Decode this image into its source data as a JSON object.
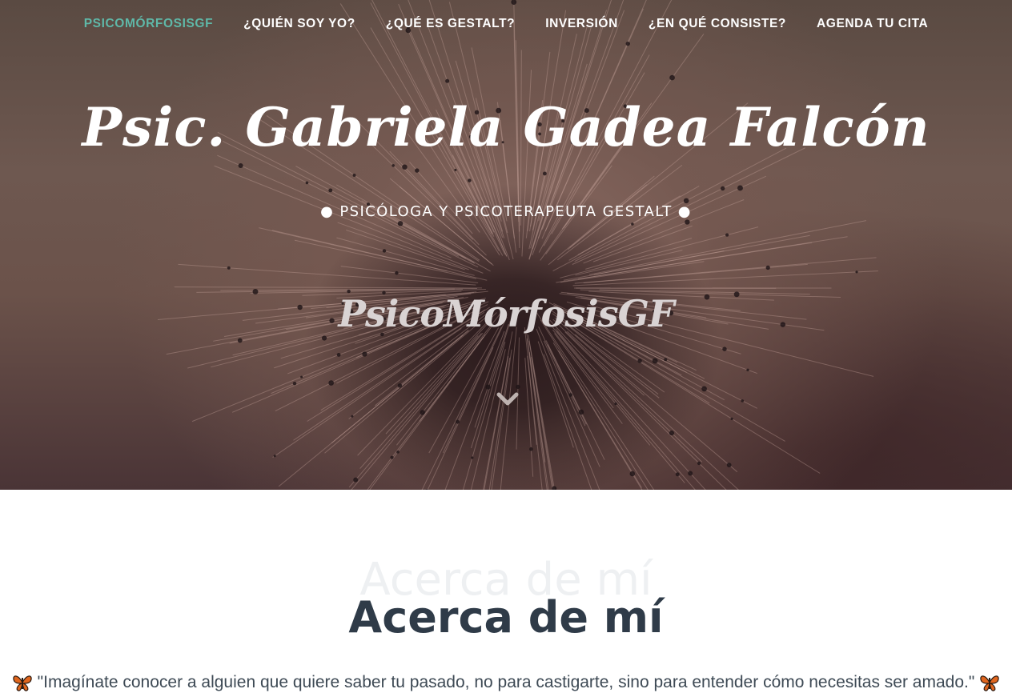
{
  "nav": {
    "brand": "PSICOMÓRFOSISGF",
    "items": [
      {
        "label": "¿QUIÉN SOY YO?"
      },
      {
        "label": "¿QUÉ ES GESTALT?"
      },
      {
        "label": "INVERSIÓN"
      },
      {
        "label": "¿EN QUÉ CONSISTE?"
      },
      {
        "label": "AGENDA TU CITA"
      }
    ]
  },
  "hero": {
    "title": "Psic. Gabriela Gadea Falcón",
    "subtitle": "● PSICÓLOGA Y PSICOTERAPEUTA GESTALT ●",
    "logo_text": "PsicoMórfosisGF",
    "scroll_icon": "chevron-down-icon"
  },
  "about": {
    "ghost_title": "Acerca de mí",
    "title": "Acerca de mí",
    "quote": "\"Imagínate conocer a alguien que quiere saber tu pasado, no para castigarte, sino para entender cómo necesitas ser amado.\"",
    "quote_icon": "butterfly-icon"
  },
  "colors": {
    "brand_accent": "#5fb8a8",
    "heading": "#2f3b48",
    "ghost_heading": "#eef0f2",
    "body_text": "#3e4a55"
  }
}
